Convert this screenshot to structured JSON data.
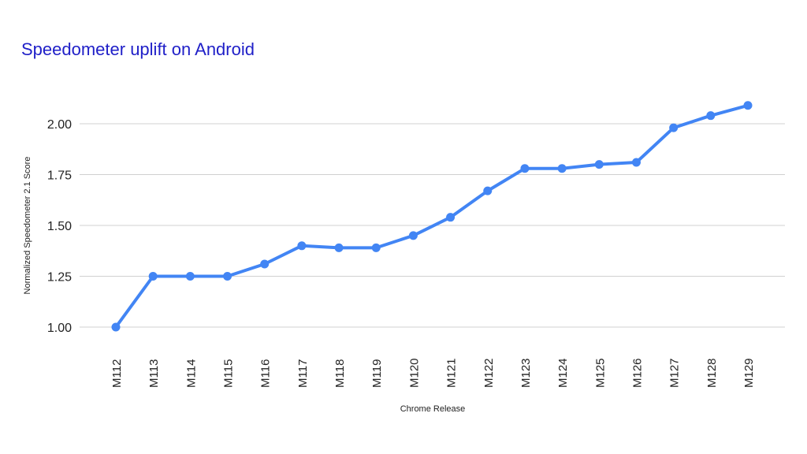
{
  "chart_data": {
    "type": "line",
    "title": "Speedometer uplift on Android",
    "xlabel": "Chrome Release",
    "ylabel": "Normalized Speedometer 2.1 Score",
    "categories": [
      "M112",
      "M113",
      "M114",
      "M115",
      "M116",
      "M117",
      "M118",
      "M119",
      "M120",
      "M121",
      "M122",
      "M123",
      "M124",
      "M125",
      "M126",
      "M127",
      "M128",
      "M129"
    ],
    "series": [
      {
        "name": "Normalized Speedometer 2.1 Score",
        "color": "#4285f4",
        "values": [
          1.0,
          1.25,
          1.25,
          1.25,
          1.31,
          1.4,
          1.39,
          1.39,
          1.45,
          1.54,
          1.67,
          1.78,
          1.78,
          1.8,
          1.81,
          1.98,
          2.04,
          2.09
        ]
      }
    ],
    "yticks": [
      1.0,
      1.25,
      1.5,
      1.75,
      2.0
    ],
    "ytick_labels": [
      "1.00",
      "1.25",
      "1.50",
      "1.75",
      "2.00"
    ],
    "ylim": [
      1.0,
      2.0
    ],
    "grid": true,
    "legend": "none",
    "title_color": "#2020c8"
  }
}
